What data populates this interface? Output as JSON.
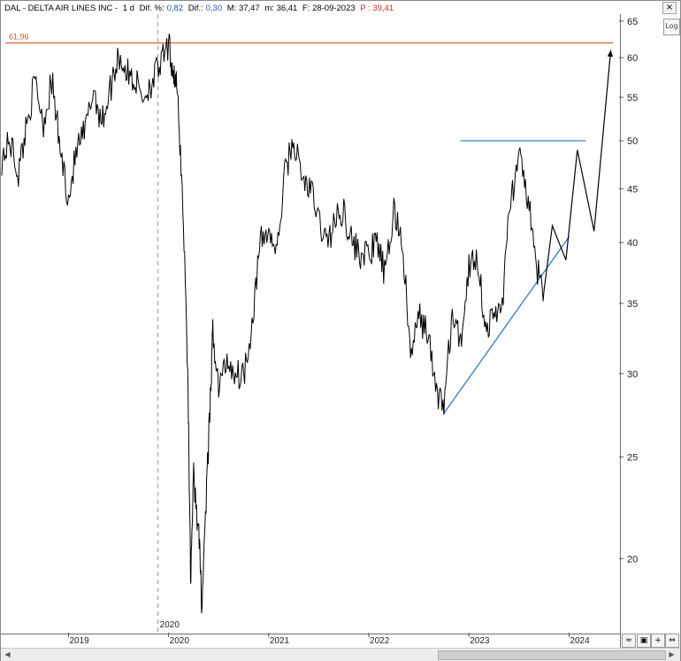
{
  "header": {
    "ticker": "DAL - DELTA AIR LINES INC -",
    "interval": "1 d",
    "dif_pct_label": "Dif. %:",
    "dif_pct_value": "0,82",
    "dif_label": "Dif.:",
    "dif_value": "0,30",
    "max_label": "M: 37,47",
    "min_label": "m: 36,41",
    "date_label": "F: 28-09-2023",
    "price_label": "P : 39,41"
  },
  "toolbar": {
    "log_label": "Log",
    "close_label": "×"
  },
  "colors": {
    "resistance": "#e8734a",
    "trend": "#1f6fd6",
    "price": "#000000",
    "marker": "#9a9a9a"
  },
  "chart_data": {
    "type": "line",
    "scale": "log",
    "ylim": [
      17,
      66
    ],
    "y_ticks": [
      20,
      25,
      30,
      35,
      40,
      45,
      50,
      55,
      60,
      65
    ],
    "x_ticks": [
      "2019",
      "2020",
      "2021",
      "2022",
      "2023",
      "2024"
    ],
    "xlim": [
      "2018-05",
      "2024-07"
    ],
    "marker_label": "2020",
    "resistance_label": "61,96",
    "resistance_level": 61.96,
    "blue_horizontal_level": 50,
    "series": [
      {
        "values": [
          [
            "2018-05",
            48
          ],
          [
            "2018-06",
            50
          ],
          [
            "2018-07",
            46.5
          ],
          [
            "2018-08",
            52
          ],
          [
            "2018-09",
            57
          ],
          [
            "2018-10",
            52
          ],
          [
            "2018-11",
            57
          ],
          [
            "2018-12",
            49
          ],
          [
            "2019-01",
            44
          ],
          [
            "2019-02",
            49
          ],
          [
            "2019-03",
            51
          ],
          [
            "2019-04",
            56
          ],
          [
            "2019-05",
            52
          ],
          [
            "2019-06",
            56
          ],
          [
            "2019-07",
            60.5
          ],
          [
            "2019-08",
            58
          ],
          [
            "2019-09",
            57
          ],
          [
            "2019-10",
            55
          ],
          [
            "2019-11",
            57
          ],
          [
            "2019-12",
            59
          ],
          [
            "2020-01",
            61.5
          ],
          [
            "2020-01-20",
            58
          ],
          [
            "2020-02",
            56
          ],
          [
            "2020-02-20",
            45
          ],
          [
            "2020-03-10",
            30
          ],
          [
            "2020-03-20",
            19
          ],
          [
            "2020-04",
            24
          ],
          [
            "2020-04-20",
            21
          ],
          [
            "2020-05",
            18
          ],
          [
            "2020-05-20",
            24
          ],
          [
            "2020-06",
            28
          ],
          [
            "2020-06-10",
            33
          ],
          [
            "2020-07",
            29
          ],
          [
            "2020-08",
            31
          ],
          [
            "2020-09",
            30
          ],
          [
            "2020-10",
            30
          ],
          [
            "2020-11",
            33.5
          ],
          [
            "2020-12",
            40
          ],
          [
            "2021-01",
            41
          ],
          [
            "2021-02",
            39
          ],
          [
            "2021-03",
            47
          ],
          [
            "2021-04",
            50
          ],
          [
            "2021-05",
            46
          ],
          [
            "2021-06",
            45
          ],
          [
            "2021-07",
            42
          ],
          [
            "2021-08",
            40
          ],
          [
            "2021-09",
            42
          ],
          [
            "2021-10",
            43
          ],
          [
            "2021-11",
            40
          ],
          [
            "2021-12",
            39
          ],
          [
            "2022-01",
            39
          ],
          [
            "2022-02",
            40
          ],
          [
            "2022-03",
            37
          ],
          [
            "2022-04",
            43
          ],
          [
            "2022-05",
            40
          ],
          [
            "2022-06",
            31
          ],
          [
            "2022-07",
            34
          ],
          [
            "2022-08",
            33
          ],
          [
            "2022-09",
            29
          ],
          [
            "2022-10",
            28
          ],
          [
            "2022-11",
            34
          ],
          [
            "2022-12",
            32
          ],
          [
            "2023-01",
            38
          ],
          [
            "2023-02",
            39
          ],
          [
            "2023-03",
            33
          ],
          [
            "2023-04",
            34
          ],
          [
            "2023-05",
            35
          ],
          [
            "2023-06",
            44
          ],
          [
            "2023-07",
            48
          ],
          [
            "2023-08",
            44.5
          ],
          [
            "2023-09",
            38
          ],
          [
            "2023-10",
            36
          ]
        ]
      },
      {
        "values": [
          [
            "2023-10",
            36
          ],
          [
            "2023-11",
            41.5
          ],
          [
            "2023-12-20",
            38.5
          ],
          [
            "2024-02",
            49
          ],
          [
            "2024-04",
            41
          ],
          [
            "2024-06",
            61
          ]
        ]
      }
    ],
    "trendlines": [
      {
        "from": [
          "2022-10",
          27.5
        ],
        "to": [
          "2024-01",
          40.5
        ]
      }
    ],
    "horizontal_segments": [
      {
        "level": 50,
        "from": "2022-12",
        "to": "2024-03"
      }
    ]
  }
}
